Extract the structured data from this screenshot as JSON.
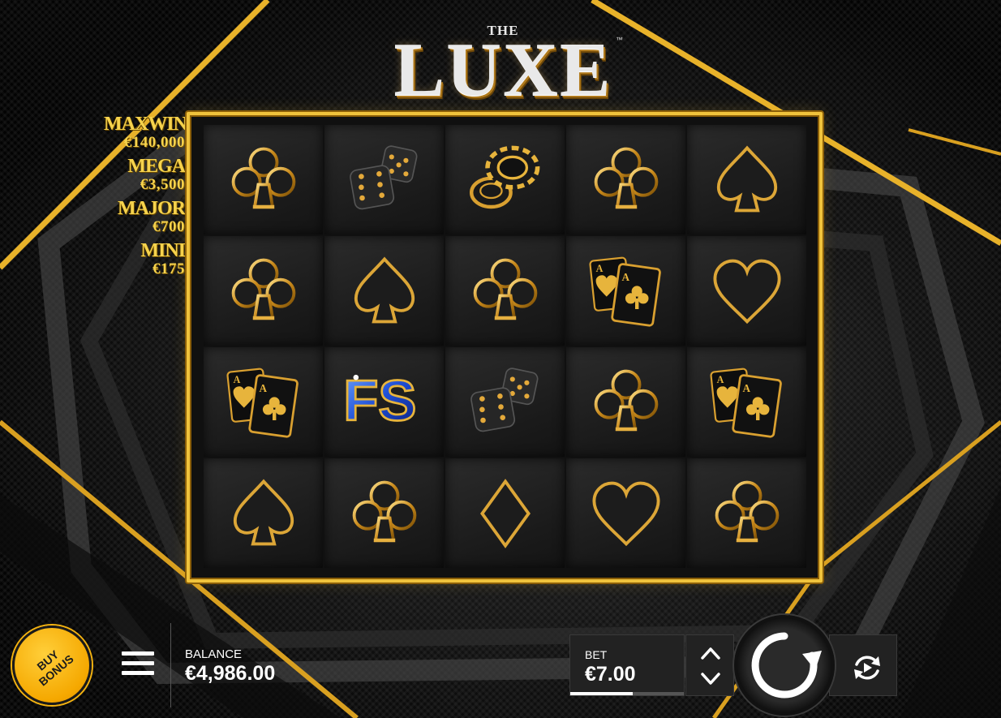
{
  "game": {
    "logo_prefix": "THE",
    "logo_title": "LUXE",
    "logo_tm": "™"
  },
  "jackpots": [
    {
      "name": "MAXWIN",
      "value": "€140,000"
    },
    {
      "name": "MEGA",
      "value": "€3,500"
    },
    {
      "name": "MAJOR",
      "value": "€700"
    },
    {
      "name": "MINI",
      "value": "€175"
    }
  ],
  "reels": [
    [
      "club",
      "dice",
      "chips",
      "club",
      "spade"
    ],
    [
      "club",
      "spade",
      "club",
      "aces",
      "heart"
    ],
    [
      "aces",
      "free-spins",
      "dice",
      "club",
      "aces"
    ],
    [
      "spade",
      "club",
      "diamond",
      "heart",
      "club"
    ]
  ],
  "free_spins_label": "FS",
  "card_rank": "A",
  "controls": {
    "buy_bonus_label": "BUY BONUS",
    "balance_label": "BALANCE",
    "balance_value": "€4,986.00",
    "bet_label": "BET",
    "bet_value": "€7.00",
    "bet_level_fraction": 0.55
  },
  "icons": {
    "menu": "hamburger-menu-icon",
    "bet_up": "chevron-up-icon",
    "bet_down": "chevron-down-icon",
    "spin": "spin-arrow-icon",
    "autoplay": "autoplay-icon"
  },
  "colors": {
    "gold": "#f0c33c",
    "gold_dark": "#8a5e08",
    "buy_bonus": "#f5a800",
    "fs_blue": "#1f4fd6"
  }
}
